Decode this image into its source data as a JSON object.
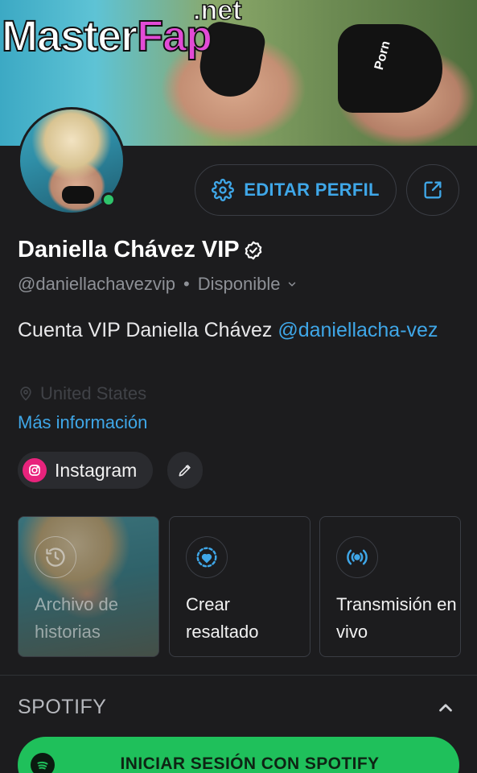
{
  "watermark": {
    "brand_main": "Master",
    "brand_accent": "Fap",
    "brand_suffix": ".net"
  },
  "cover": {
    "suit_text": "Porn"
  },
  "profile": {
    "edit_label": "EDITAR PERFIL",
    "name": "Daniella Chávez VIP",
    "handle": "@daniellachavezvip",
    "status_separator": "•",
    "status": "Disponible",
    "bio_text": "Cuenta VIP Daniella Chávez ",
    "bio_mention": "@daniellacha-vez",
    "location": "United States",
    "more_info": "Más información",
    "online_color": "#2fc46b"
  },
  "links": {
    "instagram_label": "Instagram"
  },
  "highlights": [
    {
      "label": "Archivo de historias",
      "icon": "history-clock-icon"
    },
    {
      "label": "Crear resaltado",
      "icon": "heart-circle-icon"
    },
    {
      "label": "Transmisión en vivo",
      "icon": "live-broadcast-icon"
    }
  ],
  "spotify": {
    "section_title": "SPOTIFY",
    "login_label": "INICIAR SESIÓN CON SPOTIFY",
    "brand_color": "#1fc05b"
  },
  "colors": {
    "accent": "#3fa7e8",
    "background": "#1c1c1e",
    "instagram": "#e8237c"
  }
}
